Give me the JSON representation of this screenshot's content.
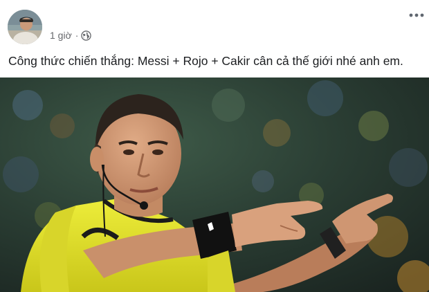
{
  "post": {
    "timestamp": "1 giờ",
    "separator": "·",
    "text": "Công thức chiến thắng: Messi + Rojo + Cakir cân cả thế giới nhé anh em.",
    "privacy_icon": "globe-icon",
    "more_icon": "more-options-icon",
    "photo_subject": "referee-pointing-photo"
  },
  "colors": {
    "text_primary": "#1c1e21",
    "text_secondary": "#65676b",
    "jersey_yellow": "#e4e21f"
  }
}
